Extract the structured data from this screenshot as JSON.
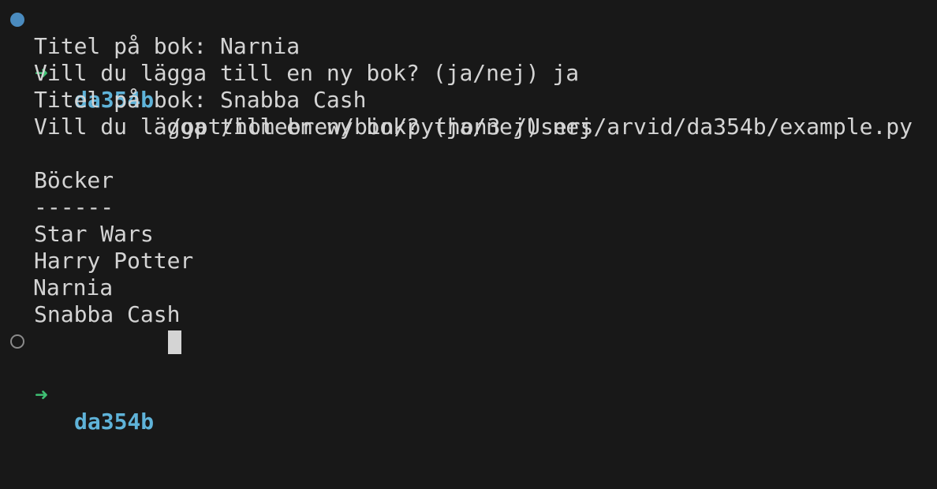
{
  "prompt": {
    "arrow": "➜",
    "cwd": "da354b"
  },
  "command": "/opt/homebrew/bin/python3 /Users/arvid/da354b/example.py",
  "output": [
    "Titel på bok: Narnia",
    "Vill du lägga till en ny bok? (ja/nej) ja",
    "Titel på bok: Snabba Cash",
    "Vill du lägga till en ny bok? (ja/nej) nej",
    "",
    "Böcker",
    "------",
    "Star Wars",
    "Harry Potter",
    "Narnia",
    "Snabba Cash"
  ],
  "colors": {
    "background": "#181818",
    "text": "#d4d4d4",
    "arrow": "#3fbf73",
    "cwd": "#5fb3d9",
    "status_dot_active": "#4a8bbf",
    "status_dot_idle": "#8a8a8a"
  }
}
